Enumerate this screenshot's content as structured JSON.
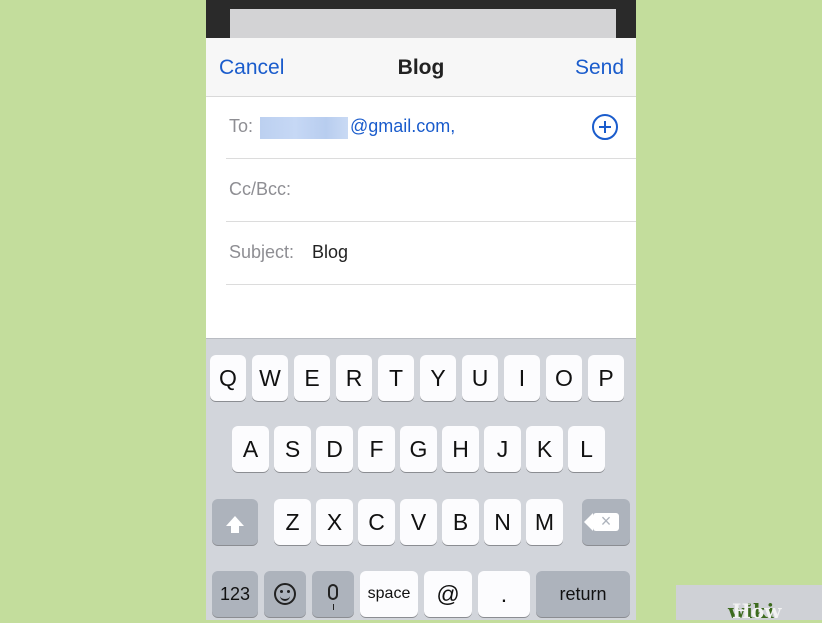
{
  "nav": {
    "cancel": "Cancel",
    "title": "Blog",
    "send": "Send"
  },
  "fields": {
    "to_label": "To:",
    "to_value": "@gmail.com,",
    "cc_label": "Cc/Bcc:",
    "subject_label": "Subject:",
    "subject_value": "Blog"
  },
  "keyboard": {
    "row1": [
      "Q",
      "W",
      "E",
      "R",
      "T",
      "Y",
      "U",
      "I",
      "O",
      "P"
    ],
    "row2": [
      "A",
      "S",
      "D",
      "F",
      "G",
      "H",
      "J",
      "K",
      "L"
    ],
    "row3": [
      "Z",
      "X",
      "C",
      "V",
      "B",
      "N",
      "M"
    ],
    "numbers": "123",
    "space": "space",
    "at": "@",
    "dot": ".",
    "return": "return"
  },
  "watermark": {
    "wiki": "wiki",
    "how": "How"
  },
  "colors": {
    "accent": "#1a5ccc",
    "background": "#c3dd9c",
    "keyboard": "#d2d5db"
  }
}
